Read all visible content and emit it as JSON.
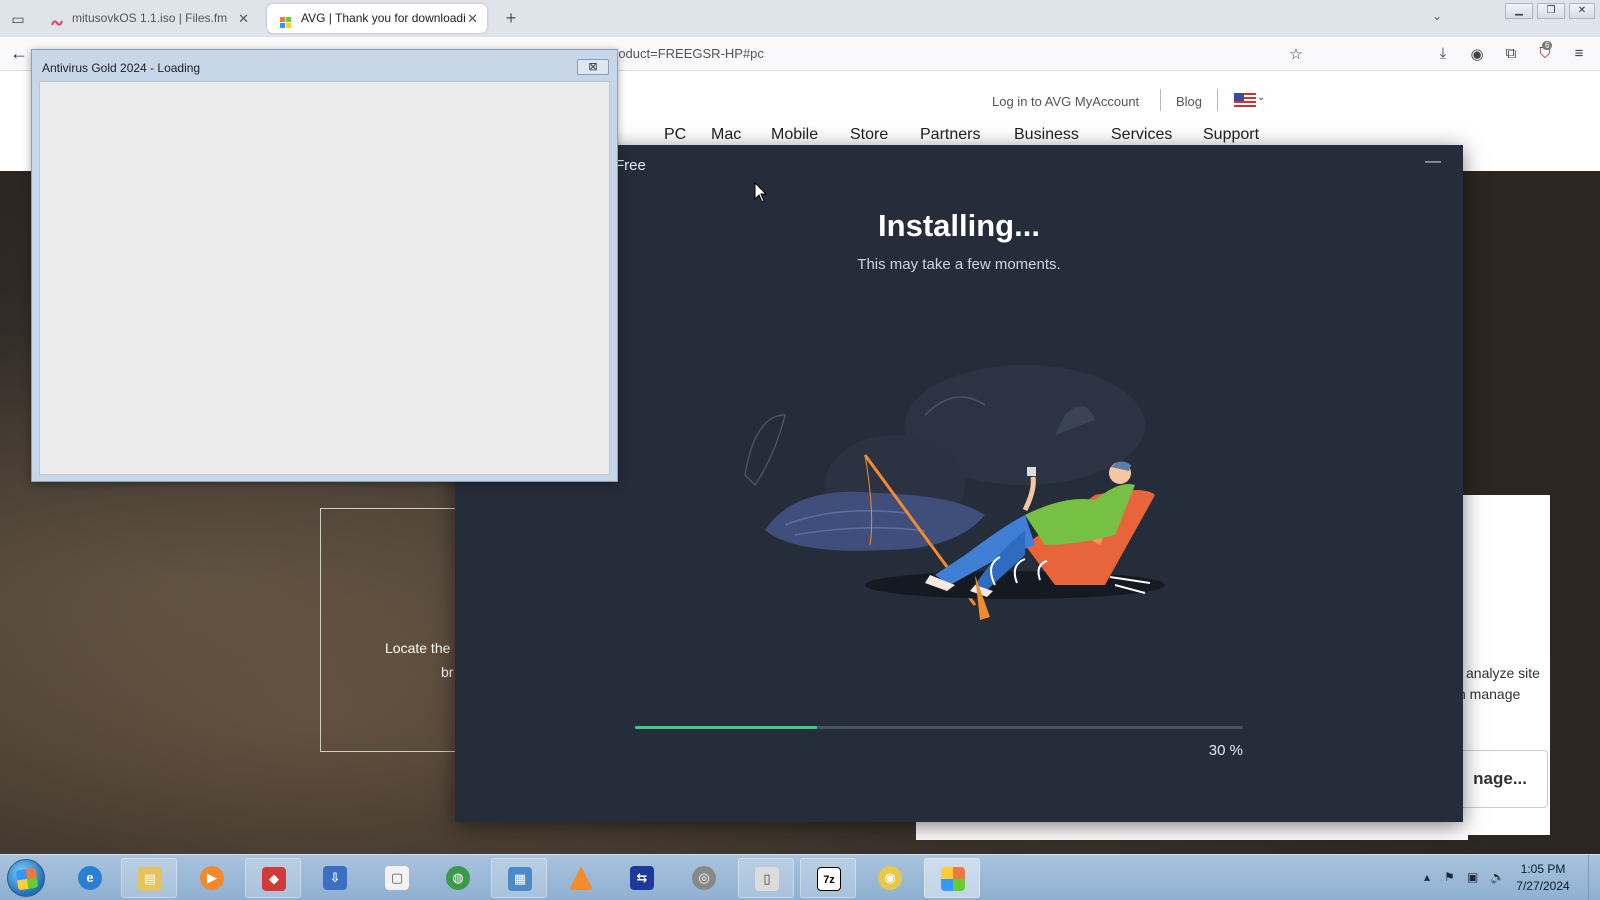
{
  "browser": {
    "tabs": [
      {
        "title": "mitusovkOS 1.1.iso | Files.fm",
        "active": false
      },
      {
        "title": "AVG | Thank you for downloadi",
        "active": true
      }
    ],
    "url": "roduct=FREEGSR-HP#pc",
    "notification_badge": "6"
  },
  "page": {
    "top_links": {
      "login": "Log in to AVG MyAccount",
      "blog": "Blog"
    },
    "nav": [
      "PC",
      "Mac",
      "Mobile",
      "Store",
      "Partners",
      "Business",
      "Services",
      "Support"
    ],
    "background_text": {
      "locate_line1": "Locate the",
      "locate_line2": "br"
    },
    "side_card": {
      "line1": "analyze site",
      "line2": "n manage",
      "button": "nage..."
    }
  },
  "installer": {
    "title_fragment": "Free",
    "heading": "Installing...",
    "subheading": "This may take a few moments.",
    "progress": 0.3,
    "progress_label": "30 %"
  },
  "loading_window": {
    "title": "Antivirus Gold 2024 - Loading"
  },
  "taskbar": {
    "clock_time": "1:05 PM",
    "clock_date": "7/27/2024"
  },
  "colors": {
    "installer_bg": "#252c3a",
    "progress_fill": "#3ec98a",
    "progress_track": "#4a5262"
  }
}
